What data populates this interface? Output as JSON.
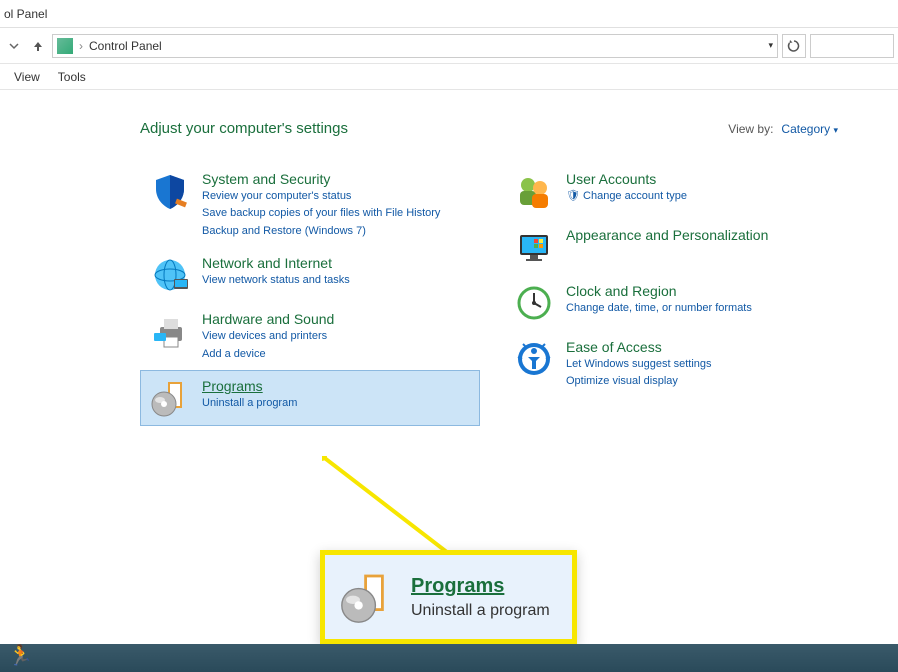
{
  "titlebar": {
    "title": "ol Panel"
  },
  "addressbar": {
    "path_label": "Control Panel"
  },
  "menubar": {
    "view": "View",
    "tools": "Tools"
  },
  "header": {
    "title": "Adjust your computer's settings",
    "viewby_label": "View by:",
    "viewby_value": "Category"
  },
  "categories_left": [
    {
      "title": "System and Security",
      "links": [
        "Review your computer's status",
        "Save backup copies of your files with File History",
        "Backup and Restore (Windows 7)"
      ],
      "icon": "shield"
    },
    {
      "title": "Network and Internet",
      "links": [
        "View network status and tasks"
      ],
      "icon": "globe"
    },
    {
      "title": "Hardware and Sound",
      "links": [
        "View devices and printers",
        "Add a device"
      ],
      "icon": "printer"
    },
    {
      "title": "Programs",
      "links": [
        "Uninstall a program"
      ],
      "icon": "disc",
      "selected": true
    }
  ],
  "categories_right": [
    {
      "title": "User Accounts",
      "links": [
        "Change account type"
      ],
      "icon": "users",
      "bullet": true
    },
    {
      "title": "Appearance and Personalization",
      "links": [],
      "icon": "desktop"
    },
    {
      "title": "Clock and Region",
      "links": [
        "Change date, time, or number formats"
      ],
      "icon": "clock"
    },
    {
      "title": "Ease of Access",
      "links": [
        "Let Windows suggest settings",
        "Optimize visual display"
      ],
      "icon": "access"
    }
  ],
  "callout": {
    "title": "Programs",
    "sub": "Uninstall a program"
  }
}
